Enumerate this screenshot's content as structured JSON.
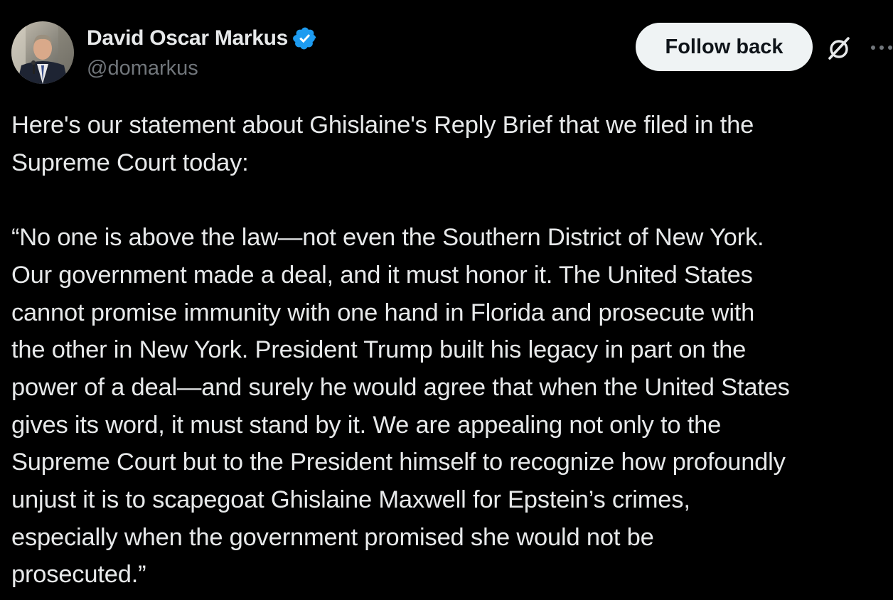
{
  "author": {
    "display_name": "David Oscar Markus",
    "handle": "@domarkus",
    "verified": true,
    "verified_color": "#1d9bf0"
  },
  "actions": {
    "follow_label": "Follow back",
    "grok_icon": "grok-icon",
    "more_icon": "more-icon"
  },
  "tweet": {
    "lines": [
      "Here's our statement about Ghislaine's Reply Brief that we filed in the",
      "Supreme Court today:",
      "",
      "“No one is above the law—not even the Southern District of New York.",
      "Our government made a deal, and it must honor it. The United States",
      "cannot promise immunity with one hand in Florida and prosecute with",
      "the other in New York. President Trump built his legacy in part on the",
      "power of a deal—and surely he would agree that when the United States",
      "gives its word, it must stand by it. We are appealing not only to the",
      "Supreme Court but to the President himself to recognize how profoundly",
      "unjust it is to scapegoat Ghislaine Maxwell for Epstein’s crimes,",
      "especially when the government promised she would not be",
      "prosecuted.”"
    ]
  },
  "colors": {
    "background": "#000000",
    "text_primary": "#e7e9ea",
    "text_secondary": "#71767b",
    "button_bg": "#eff3f4",
    "button_text": "#0f1419"
  }
}
